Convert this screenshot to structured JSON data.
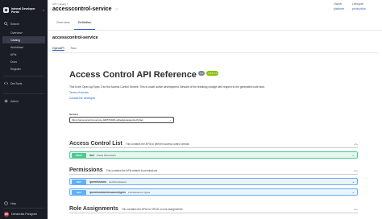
{
  "sidebar": {
    "brand": "Internal Developer Portal",
    "search": "Search",
    "items": [
      {
        "label": "Overview",
        "active": false
      },
      {
        "label": "Catalog",
        "active": true
      },
      {
        "label": "Workflows",
        "active": false
      },
      {
        "label": "APIs",
        "active": false
      },
      {
        "label": "Docs",
        "active": false
      },
      {
        "label": "Register",
        "active": false
      }
    ],
    "devtools": "DevTools",
    "admin": "Admin",
    "help": "Help",
    "user_name": "Debabrata Panigrahi",
    "user_initials": "DP"
  },
  "header": {
    "breadcrumb": "API / catalog / ",
    "title": "accesscontrol-service",
    "owner_label": "Owner",
    "owner_value": "platform",
    "lifecycle_label": "Lifecycle",
    "lifecycle_value": "production",
    "tabs": [
      "Overview",
      "Definition"
    ]
  },
  "definition": {
    "title": "accesscontrol-service",
    "subtabs": [
      "OpenAPI",
      "Raw"
    ]
  },
  "api": {
    "title": "Access Control API Reference",
    "version": "1.0",
    "oas": "OAS 3.0",
    "description": "This is the Open Api Spec 3 for the Access Control Service. This is under active development. Beware of the breaking change with respect to the generated code stub.",
    "terms": "Terms of service",
    "contact": "Contact the developer",
    "servers_label": "Servers",
    "server_url": "https://accesscontrol-service-9d0570048-ux8egkgateway/authz/api"
  },
  "sections": [
    {
      "name": "Access Control List",
      "desc": "This contains the APIs to perform access control checks",
      "ops": [
        {
          "method": "POST",
          "path": "/acl",
          "summary": "Check Permission"
        }
      ]
    },
    {
      "name": "Permissions",
      "desc": "This contains the APIs related to permissions",
      "ops": [
        {
          "method": "GET",
          "path": "/permissions",
          "summary": "List Permissions"
        },
        {
          "method": "GET",
          "path": "/permissions/resourcetypes",
          "summary": "List Resource Types"
        }
      ]
    },
    {
      "name": "Role Assignments",
      "desc": "This contains the APIs for CRUD on role assignments",
      "ops": []
    }
  ]
}
